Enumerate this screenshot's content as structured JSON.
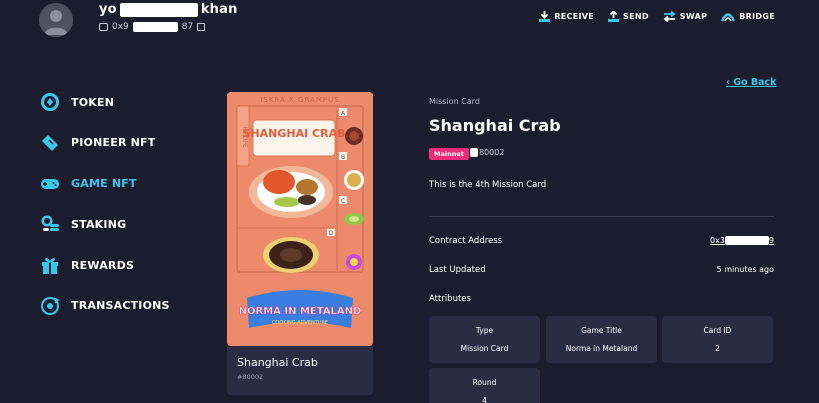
{
  "header": {
    "user_name_start": "yo",
    "user_name_end": "khan",
    "wallet_address_start": "0x9",
    "wallet_address_end": "87",
    "actions": [
      {
        "label": "RECEIVE",
        "icon": "receive-icon"
      },
      {
        "label": "SEND",
        "icon": "send-icon"
      },
      {
        "label": "SWAP",
        "icon": "swap-icon"
      },
      {
        "label": "BRIDGE",
        "icon": "bridge-icon"
      }
    ]
  },
  "sidebar": {
    "items": [
      {
        "label": "TOKEN",
        "icon": "token-icon",
        "active": false
      },
      {
        "label": "PIONEER NFT",
        "icon": "ticket-icon",
        "active": false
      },
      {
        "label": "GAME NFT",
        "icon": "gamepad-icon",
        "active": true
      },
      {
        "label": "STAKING",
        "icon": "coins-icon",
        "active": false
      },
      {
        "label": "REWARDS",
        "icon": "gift-icon",
        "active": false
      },
      {
        "label": "TRANSACTIONS",
        "icon": "transactions-icon",
        "active": false
      }
    ]
  },
  "card": {
    "image": {
      "brand": "ISKRA X GRAMPUS",
      "recipe_tab": "RECIPE",
      "dish_title": "SHANGHAI CRAB",
      "slot_labels": [
        "A",
        "B",
        "C",
        "D"
      ],
      "logo_main": "NORMA IN METALAND",
      "logo_sub": "COOKING ADVENTURE"
    },
    "title": "Shanghai Crab",
    "number": "#80002"
  },
  "detail": {
    "go_back": "Go Back",
    "category": "Mission Card",
    "title": "Shanghai Crab",
    "network_badge": "Mainnet",
    "token_id_suffix": "80002",
    "description": "This is the 4th Mission Card",
    "contract_address_label": "Contract Address",
    "contract_address_start": "0x3",
    "contract_address_end": "9",
    "last_updated_label": "Last Updated",
    "last_updated_value": "5 minutes ago",
    "attributes_title": "Attributes",
    "attributes": [
      {
        "key": "Type",
        "value": "Mission Card"
      },
      {
        "key": "Game Title",
        "value": "Norma in Metaland"
      },
      {
        "key": "Card ID",
        "value": "2"
      },
      {
        "key": "Round",
        "value": "4"
      }
    ]
  },
  "colors": {
    "background": "#1b1c2e",
    "panel": "#2a2c43",
    "accent": "#37c8ee",
    "badge": "#ee2a7b",
    "card": "#ed8a6b"
  }
}
